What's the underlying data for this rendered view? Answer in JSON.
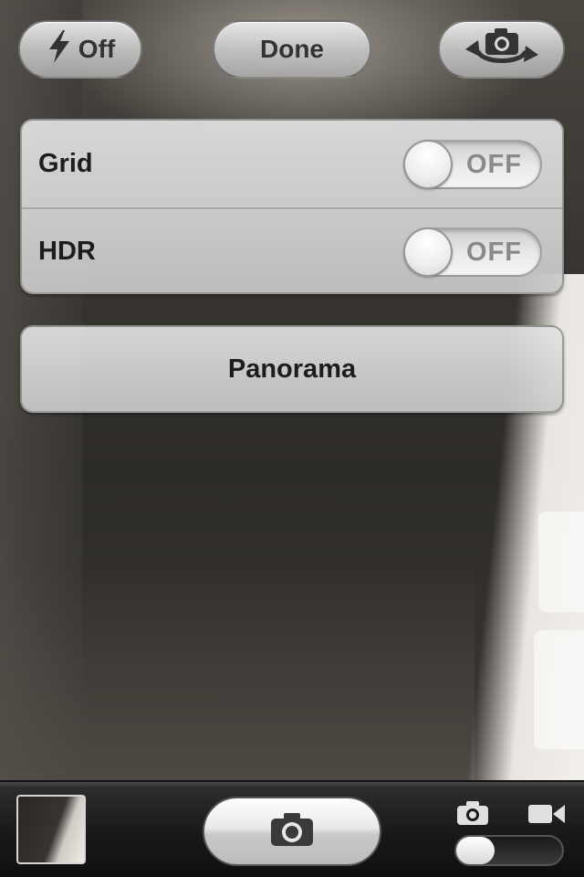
{
  "top_bar": {
    "flash_label": "Off",
    "done_label": "Done"
  },
  "settings": {
    "grid": {
      "label": "Grid",
      "state": "OFF"
    },
    "hdr": {
      "label": "HDR",
      "state": "OFF"
    }
  },
  "panorama_label": "Panorama",
  "icons": {
    "flash": "lightning-bolt-icon",
    "flip_camera": "camera-rotate-icon",
    "shutter": "camera-icon",
    "mode_photo": "camera-icon",
    "mode_video": "video-camera-icon"
  },
  "colors": {
    "panel_text": "#1d1d1d",
    "toggle_text": "#8a8a8a",
    "toolbar": "#1a1a1a"
  }
}
